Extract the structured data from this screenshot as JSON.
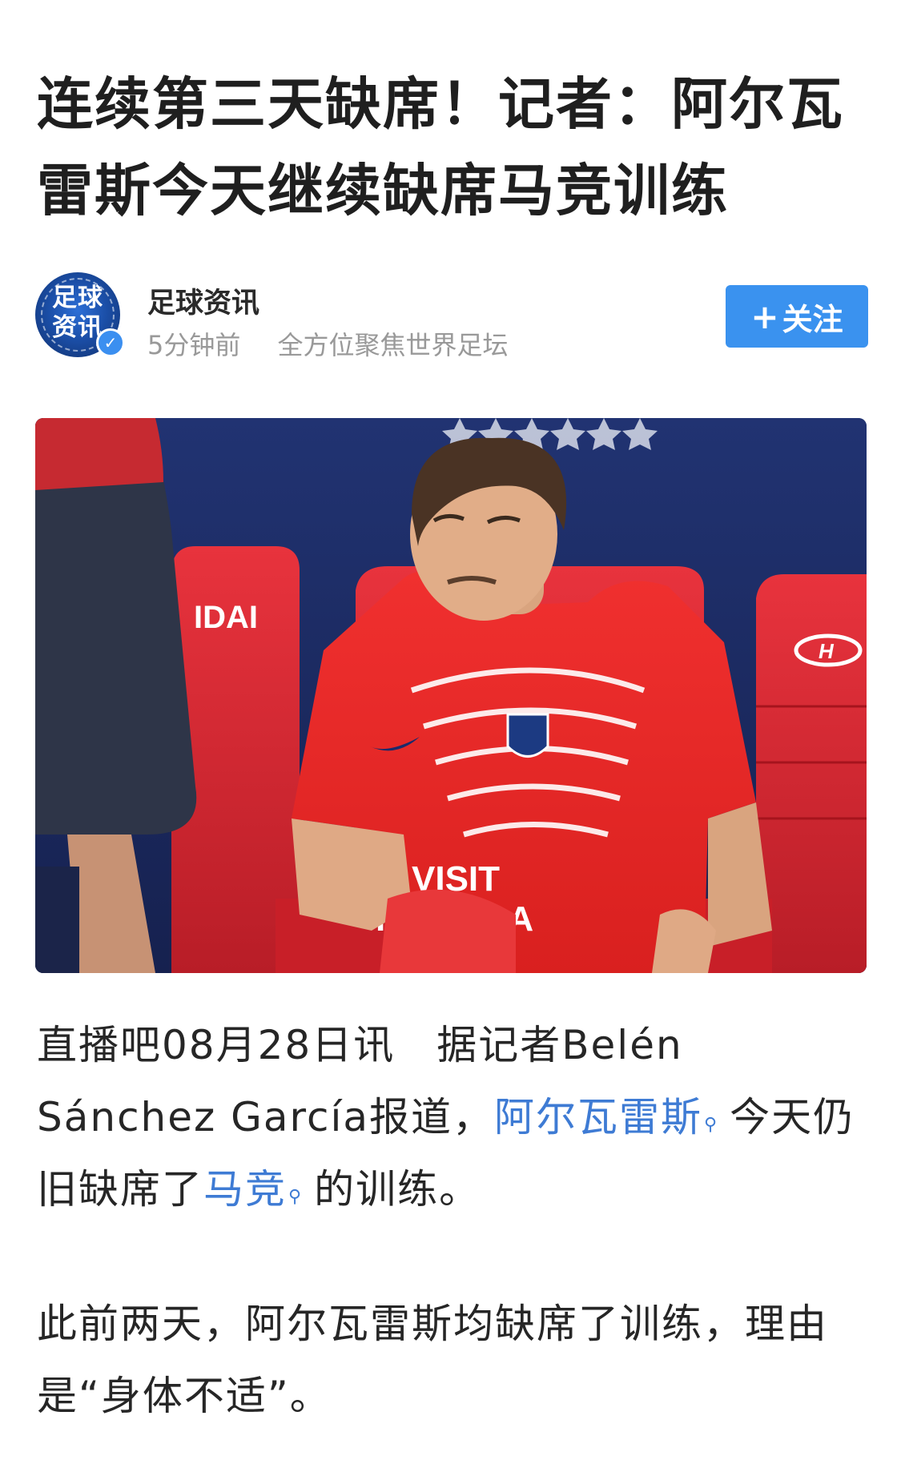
{
  "article": {
    "title_line1": "连续第三天缺席！记者：阿尔瓦",
    "title_line2": "雷斯今天继续缺席马竞训练"
  },
  "author": {
    "avatar_text_line1": "足球",
    "avatar_text_line2": "资讯",
    "name": "足球资讯",
    "time": "5分钟前",
    "description": "全方位聚焦世界足坛",
    "follow_label": "关注",
    "verified": true
  },
  "photo": {
    "jersey_text_line1": "VISIT",
    "jersey_text_line2": "RWANDA",
    "seat_text": "IDAI"
  },
  "body": {
    "p1_part1": "直播吧08月28日讯　据记者Belén Sánchez García报道，",
    "p1_link1": "阿尔瓦雷斯",
    "p1_part2": "今天仍旧缺席了",
    "p1_link2": "马竞",
    "p1_part3": "的训练。",
    "p2": "此前两天，阿尔瓦雷斯均缺席了训练，理由是“身体不适”。"
  },
  "colors": {
    "accent": "#3a92ef",
    "link": "#3e7bd4",
    "meta": "#999999"
  },
  "icons": {
    "search_link_icon": "magnifier",
    "verified_badge": "check"
  }
}
